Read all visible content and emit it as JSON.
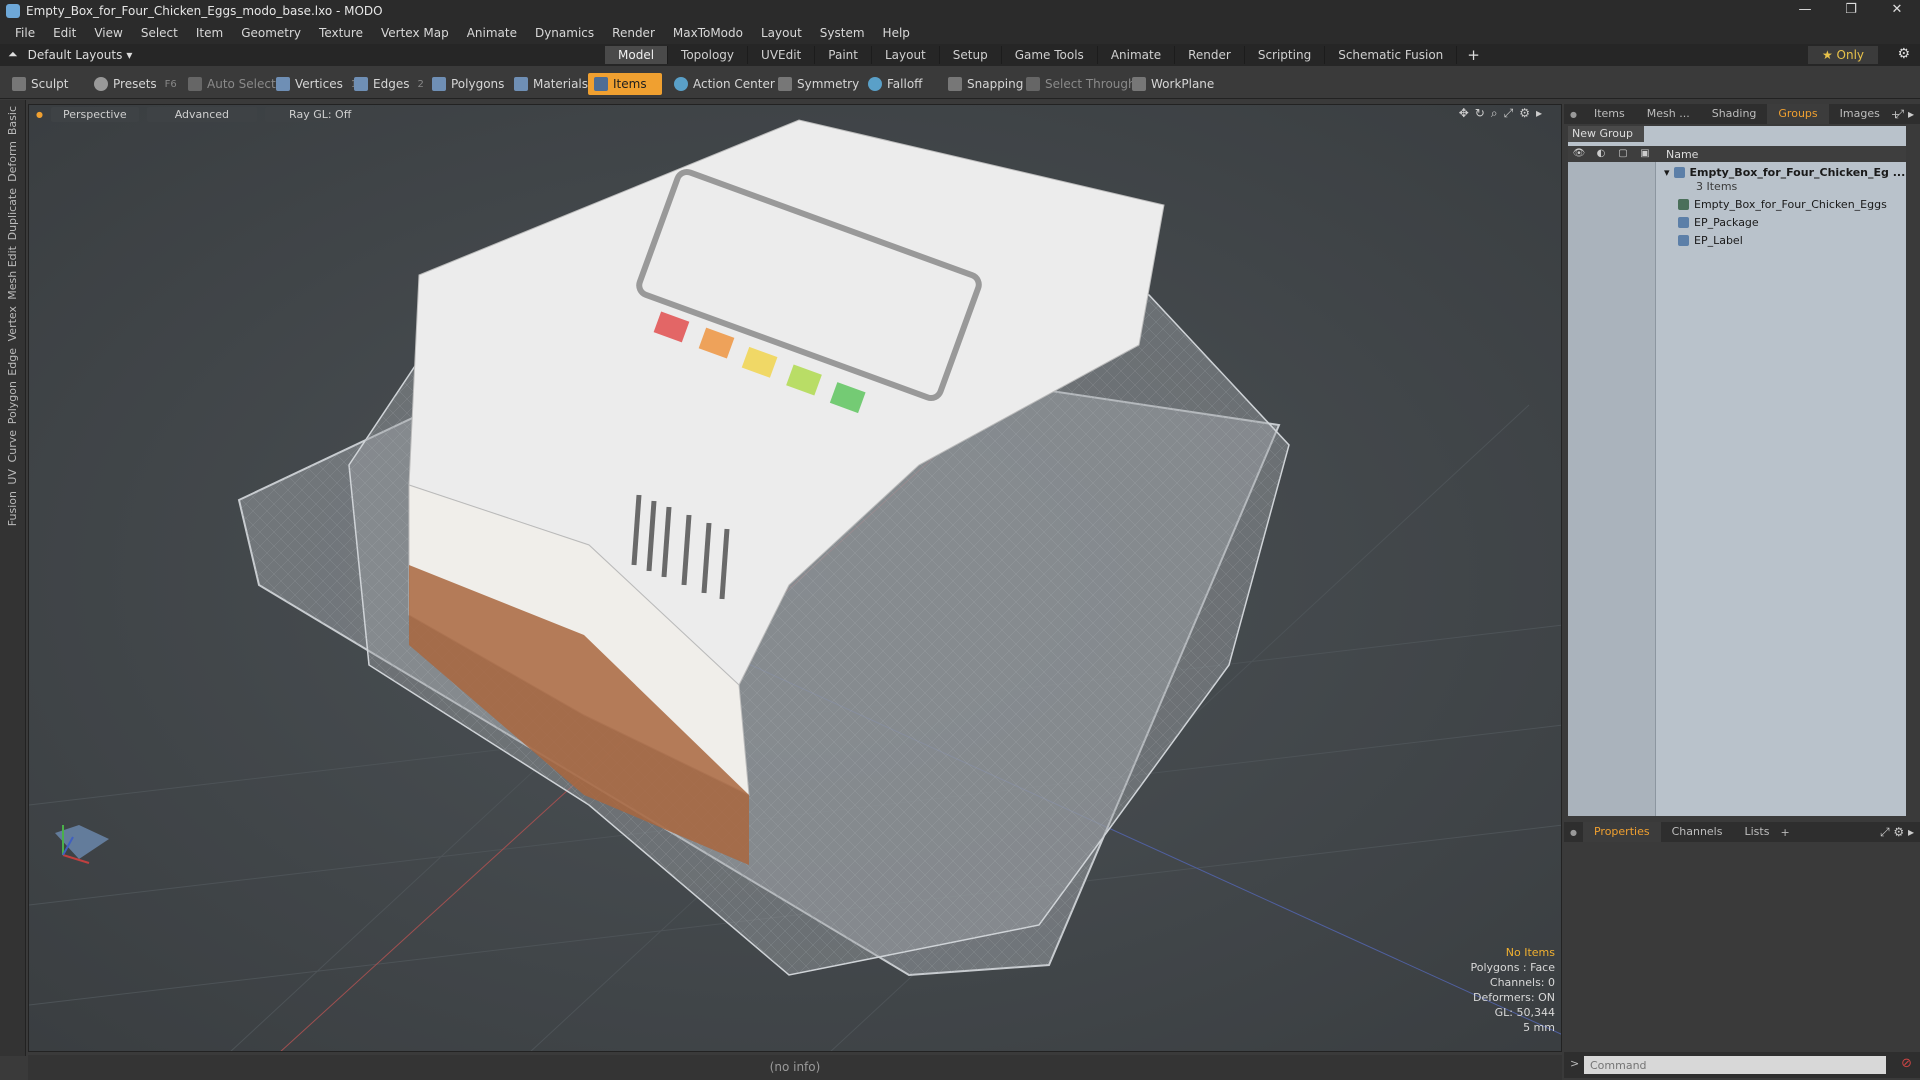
{
  "window": {
    "title": "Empty_Box_for_Four_Chicken_Eggs_modo_base.lxo - MODO",
    "controls": [
      "—",
      "❐",
      "✕"
    ]
  },
  "menu": [
    "File",
    "Edit",
    "View",
    "Select",
    "Item",
    "Geometry",
    "Texture",
    "Vertex Map",
    "Animate",
    "Dynamics",
    "Render",
    "MaxToModo",
    "Layout",
    "System",
    "Help"
  ],
  "layout": {
    "selector": "Default Layouts",
    "tabs": [
      "Model",
      "Topology",
      "UVEdit",
      "Paint",
      "Layout",
      "Setup",
      "Game Tools",
      "Animate",
      "Render",
      "Scripting",
      "Schematic Fusion"
    ],
    "active_tab": "Model",
    "only_label": "Only"
  },
  "toolbar": {
    "sculpt": "Sculpt",
    "presets": "Presets",
    "presets_key": "F6",
    "auto_select": "Auto Select",
    "vertices": "Vertices",
    "vertices_count": "1",
    "edges": "Edges",
    "edges_count": "2",
    "polygons": "Polygons",
    "materials": "Materials",
    "items": "Items",
    "action_center": "Action Center",
    "symmetry": "Symmetry",
    "falloff": "Falloff",
    "snapping": "Snapping",
    "select_through": "Select Through",
    "workplane": "WorkPlane"
  },
  "side_tabs": [
    "Basic",
    "Deform",
    "Duplicate",
    "Mesh Edit",
    "Vertex",
    "Edge",
    "Polygon",
    "Curve",
    "UV",
    "Fusion"
  ],
  "viewport": {
    "view": "Perspective",
    "mode": "Advanced",
    "raygl": "Ray GL: Off",
    "stats": {
      "selection": "No Items",
      "polygons": "Polygons : Face",
      "channels": "Channels: 0",
      "deformers": "Deformers: ON",
      "gl": "GL: 50,344",
      "scale": "5 mm"
    }
  },
  "status": "(no info)",
  "right_panel": {
    "tabs": [
      "Items",
      "Mesh ...",
      "Shading",
      "Groups",
      "Images"
    ],
    "active_tab": "Groups",
    "new_group": "New Group",
    "column_name": "Name",
    "group": {
      "name": "Empty_Box_for_Four_Chicken_Eg ...",
      "count": "3 Items",
      "children": [
        "Empty_Box_for_Four_Chicken_Eggs",
        "EP_Package",
        "EP_Label"
      ]
    },
    "bottom_tabs": [
      "Properties",
      "Channels",
      "Lists"
    ],
    "bottom_active": "Properties",
    "command_placeholder": "Command"
  },
  "colors": {
    "accent": "#f0a030",
    "viewport_bg": "#42474a",
    "groups_bg": "#b9c2cb"
  }
}
